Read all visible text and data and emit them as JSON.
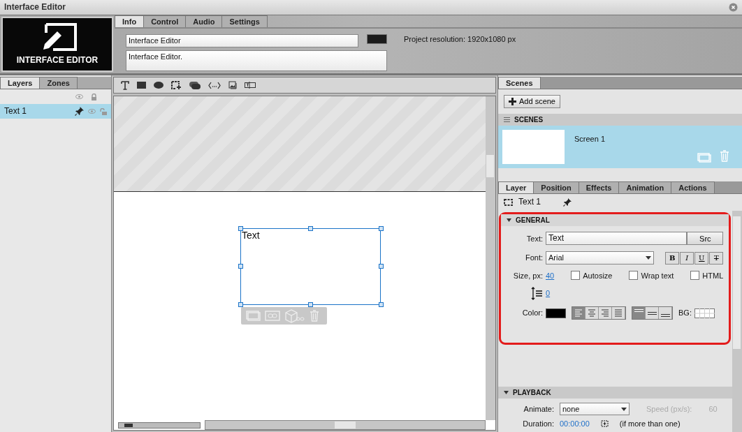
{
  "window": {
    "title": "Interface Editor"
  },
  "logo": {
    "label": "INTERFACE EDITOR"
  },
  "top_tabs": [
    {
      "label": "Info",
      "selected": true
    },
    {
      "label": "Control",
      "selected": false
    },
    {
      "label": "Audio",
      "selected": false
    },
    {
      "label": "Settings",
      "selected": false
    }
  ],
  "info": {
    "name": "Interface Editor",
    "description": "Interface Editor.",
    "resolution": "Project resolution: 1920x1080 px"
  },
  "layers_panel": {
    "tabs": [
      {
        "label": "Layers",
        "selected": true
      },
      {
        "label": "Zones",
        "selected": false
      }
    ],
    "layers": [
      {
        "name": "Text 1",
        "selected": true
      }
    ]
  },
  "canvas": {
    "text_element": {
      "text": "Text"
    },
    "zoom_slider": {
      "level": 0.08
    }
  },
  "scenes_panel": {
    "tabs": [
      {
        "label": "Scenes",
        "selected": true
      }
    ],
    "add_button": "Add scene",
    "section_title": "SCENES",
    "scenes": [
      {
        "name": "Screen 1",
        "selected": true
      }
    ]
  },
  "properties": {
    "tabs": [
      {
        "label": "Layer",
        "selected": true
      },
      {
        "label": "Position",
        "selected": false
      },
      {
        "label": "Effects",
        "selected": false
      },
      {
        "label": "Animation",
        "selected": false
      },
      {
        "label": "Actions",
        "selected": false
      }
    ],
    "layer_name": "Text 1",
    "general": {
      "title": "GENERAL",
      "text_label": "Text:",
      "text_value": "Text",
      "src_button": "Src",
      "font_label": "Font:",
      "font_value": "Arial",
      "styles": [
        {
          "label": "B",
          "kind": "bold",
          "selected": false
        },
        {
          "label": "I",
          "kind": "italic",
          "selected": false
        },
        {
          "label": "U",
          "kind": "underline",
          "selected": false
        },
        {
          "label": "T",
          "kind": "strike",
          "selected": false
        }
      ],
      "size_label": "Size, px:",
      "size_value": "40",
      "checkboxes": [
        {
          "label": "Autosize",
          "checked": false
        },
        {
          "label": "Wrap text",
          "checked": false
        },
        {
          "label": "HTML",
          "checked": false
        }
      ],
      "line_spacing": "0",
      "color_label": "Color:",
      "color": "#000000",
      "h_align": [
        {
          "kind": "left",
          "selected": true
        },
        {
          "kind": "center",
          "selected": false
        },
        {
          "kind": "right",
          "selected": false
        },
        {
          "kind": "justify",
          "selected": false
        }
      ],
      "v_align": [
        {
          "kind": "top",
          "selected": true
        },
        {
          "kind": "middle",
          "selected": false
        },
        {
          "kind": "bottom",
          "selected": false
        }
      ],
      "bg_label": "BG:"
    },
    "playback": {
      "title": "PLAYBACK",
      "animate_label": "Animate:",
      "animate_value": "none",
      "speed_label": "Speed (px/s):",
      "speed_value": "60",
      "speed_disabled": true,
      "duration_label": "Duration:",
      "duration_value": "00:00:00",
      "duration_note": "(if more than one)"
    }
  }
}
